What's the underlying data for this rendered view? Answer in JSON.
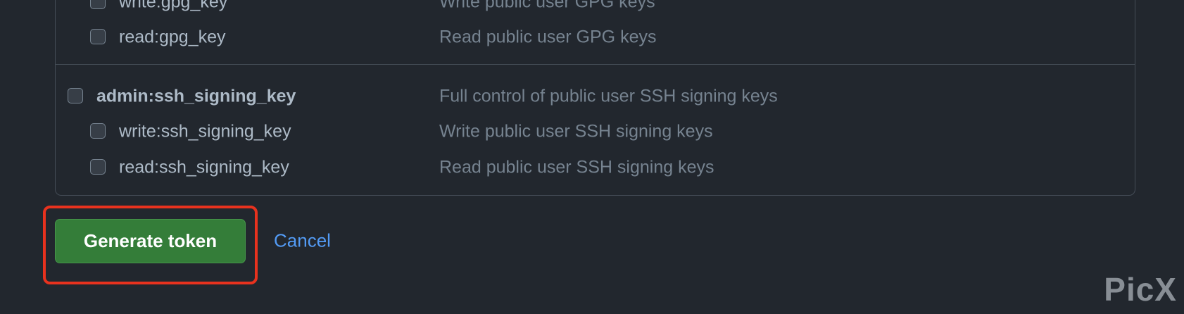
{
  "scopes": {
    "gpg_write": {
      "name": "write:gpg_key",
      "desc": "Write public user GPG keys"
    },
    "gpg_read": {
      "name": "read:gpg_key",
      "desc": "Read public user GPG keys"
    },
    "ssh_admin": {
      "name": "admin:ssh_signing_key",
      "desc": "Full control of public user SSH signing keys"
    },
    "ssh_write": {
      "name": "write:ssh_signing_key",
      "desc": "Write public user SSH signing keys"
    },
    "ssh_read": {
      "name": "read:ssh_signing_key",
      "desc": "Read public user SSH signing keys"
    }
  },
  "actions": {
    "generate_label": "Generate token",
    "cancel_label": "Cancel"
  },
  "watermark": "PicX",
  "colors": {
    "background": "#22272e",
    "border": "#444c56",
    "text": "#adbac7",
    "muted_text": "#768390",
    "primary_button": "#347d39",
    "link": "#539bf5",
    "highlight": "#e8321e"
  }
}
